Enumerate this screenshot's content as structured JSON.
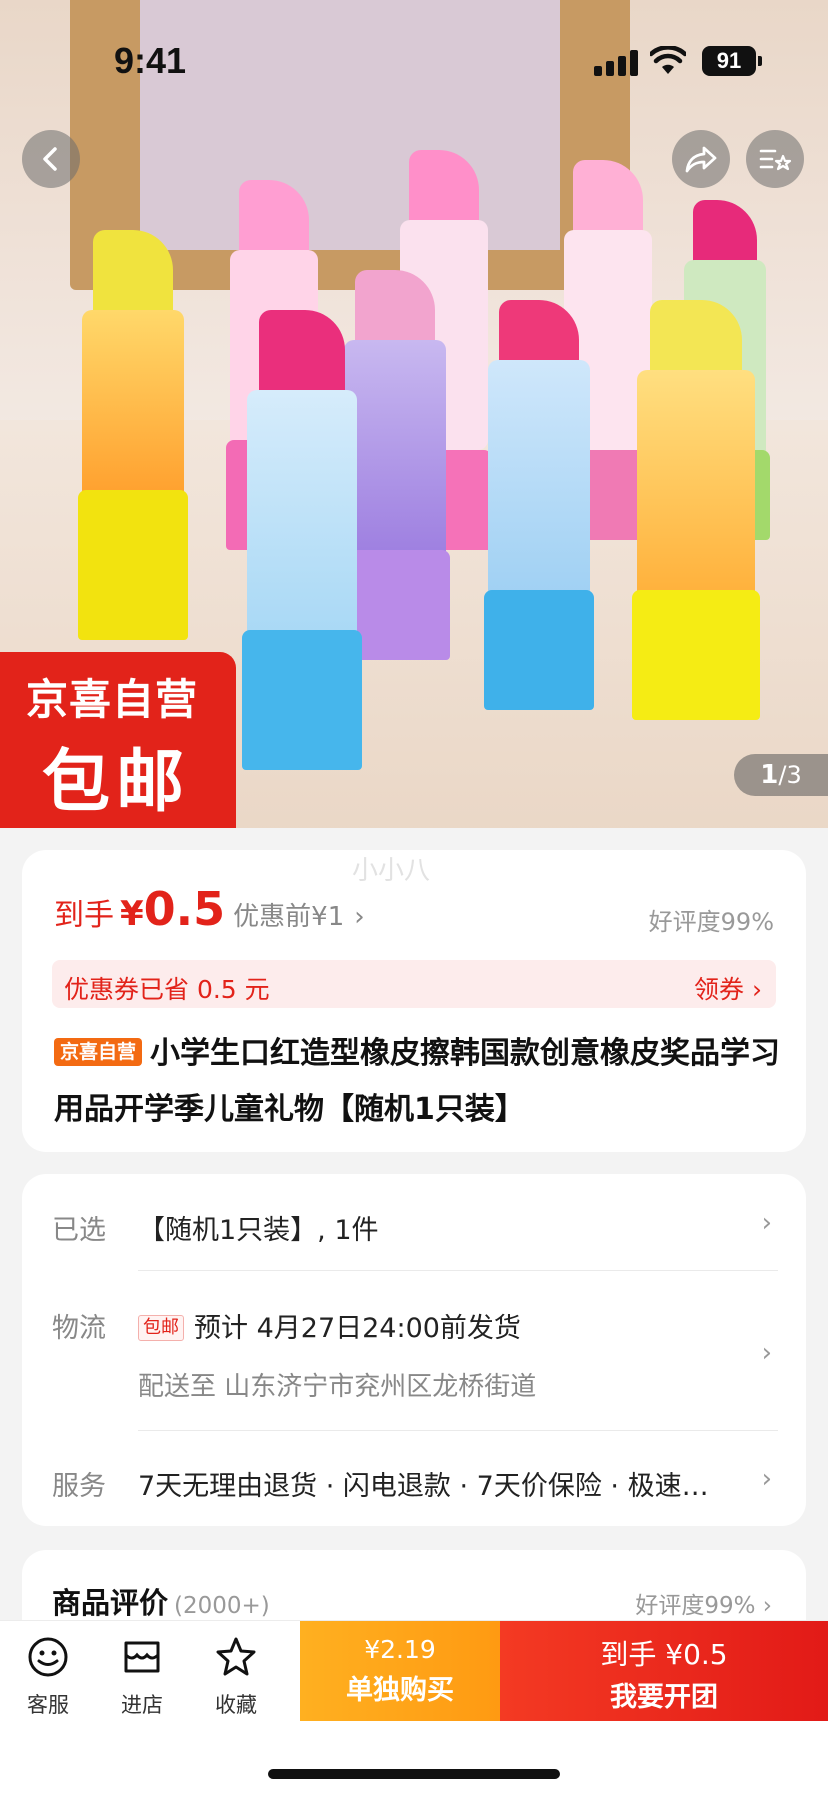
{
  "status": {
    "time": "9:41",
    "battery": "91"
  },
  "hero": {
    "badge_line1": "京喜自营",
    "badge_line2": "包邮",
    "page_current": "1",
    "page_total": "/3"
  },
  "price": {
    "label": "到手",
    "currency": "¥",
    "amount": "0.5",
    "original": "优惠前¥1",
    "rating": "好评度99%",
    "watermark": "小小八"
  },
  "coupon": {
    "text": "优惠券已省 0.5 元",
    "action": "领券 ›"
  },
  "product": {
    "tag": "京喜自营",
    "title": "小学生口红造型橡皮擦韩国款创意橡皮奖品学习用品开学季儿童礼物【随机1只装】"
  },
  "options": {
    "selected_label": "已选",
    "selected_value": "【随机1只装】, 1件",
    "shipping_label": "物流",
    "shipping_tag": "包邮",
    "shipping_value": "预计 4月27日24:00前发货",
    "delivery_to": "配送至 山东济宁市兖州区龙桥街道",
    "service_label": "服务",
    "service_value": "7天无理由退货 · 闪电退款 · 7天价保险 · 极速…"
  },
  "reviews": {
    "title": "商品评价",
    "count": "(2000+)",
    "rating": "好评度99%"
  },
  "bottom": {
    "service": "客服",
    "store": "进店",
    "favorite": "收藏",
    "alone_price": "¥2.19",
    "alone_label": "单独购买",
    "group_price": "到手 ¥0.5",
    "group_label": "我要开团"
  },
  "colors": {
    "accent": "#e2231a",
    "orange": "#ff9a12",
    "tag_orange": "#f36a12"
  }
}
